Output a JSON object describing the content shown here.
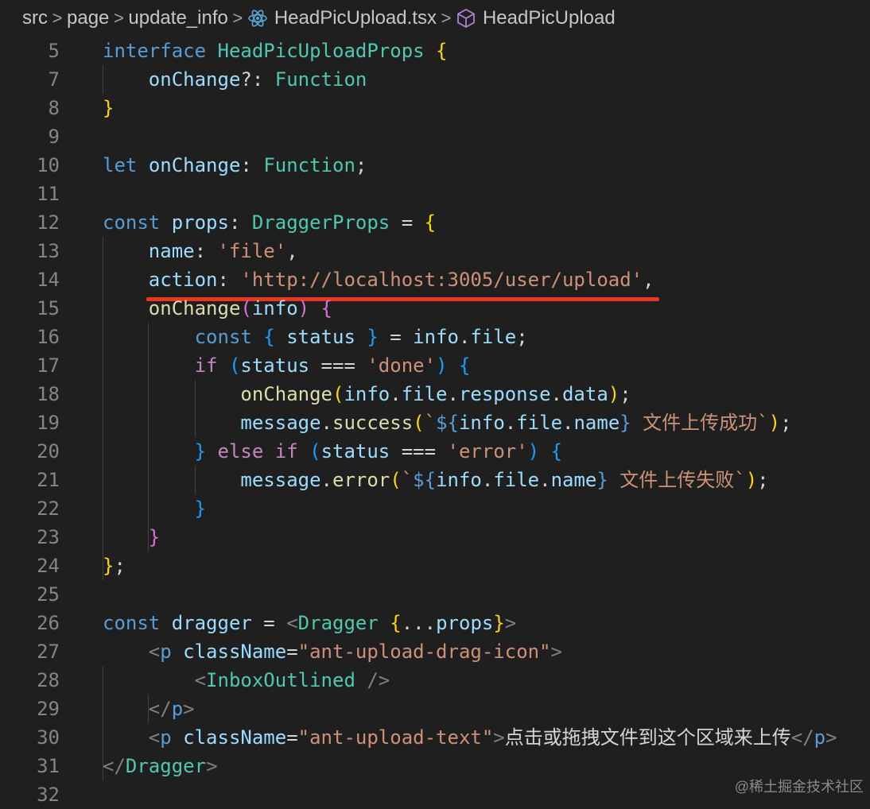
{
  "breadcrumb": {
    "items": [
      "src",
      "page",
      "update_info",
      "HeadPicUpload.tsx",
      "HeadPicUpload"
    ],
    "separator": ">",
    "file_icon": "react-icon",
    "symbol_icon": "cube-icon"
  },
  "colors": {
    "background": "#1f1f1f",
    "keyword": "#569cd6",
    "control": "#c586c0",
    "type": "#4ec9b0",
    "variable": "#9cdcfe",
    "function": "#dcdcaa",
    "string": "#ce9178",
    "bracket_1": "#ffd700",
    "bracket_2": "#da70d6",
    "bracket_3": "#179fff",
    "highlight_underline": "#e8361f"
  },
  "code_lines": [
    {
      "num": "5",
      "tokens": [
        [
          "kw",
          "interface"
        ],
        [
          "pu",
          " "
        ],
        [
          "ty",
          "HeadPicUploadProps"
        ],
        [
          "pu",
          " "
        ],
        [
          "br1",
          "{"
        ]
      ]
    },
    {
      "num": "7",
      "tokens": [
        [
          "pu",
          "    "
        ],
        [
          "id",
          "onChange"
        ],
        [
          "pu",
          "?: "
        ],
        [
          "ty",
          "Function"
        ]
      ]
    },
    {
      "num": "8",
      "tokens": [
        [
          "br1",
          "}"
        ]
      ]
    },
    {
      "num": "9",
      "tokens": []
    },
    {
      "num": "10",
      "tokens": [
        [
          "kw",
          "let"
        ],
        [
          "pu",
          " "
        ],
        [
          "id",
          "onChange"
        ],
        [
          "pu",
          ": "
        ],
        [
          "ty",
          "Function"
        ],
        [
          "pu",
          ";"
        ]
      ]
    },
    {
      "num": "11",
      "tokens": []
    },
    {
      "num": "12",
      "tokens": [
        [
          "kw",
          "const"
        ],
        [
          "pu",
          " "
        ],
        [
          "id",
          "props"
        ],
        [
          "pu",
          ": "
        ],
        [
          "ty",
          "DraggerProps"
        ],
        [
          "pu",
          " = "
        ],
        [
          "br1",
          "{"
        ]
      ]
    },
    {
      "num": "13",
      "tokens": [
        [
          "pu",
          "    "
        ],
        [
          "id",
          "name"
        ],
        [
          "pu",
          ": "
        ],
        [
          "str",
          "'file'"
        ],
        [
          "pu",
          ","
        ]
      ]
    },
    {
      "num": "14",
      "tokens": [
        [
          "pu",
          "    "
        ],
        [
          "id",
          "action"
        ],
        [
          "pu",
          ": "
        ],
        [
          "str",
          "'http://localhost:3005/user/upload'"
        ],
        [
          "pu",
          ","
        ]
      ]
    },
    {
      "num": "15",
      "tokens": [
        [
          "pu",
          "    "
        ],
        [
          "fn",
          "onChange"
        ],
        [
          "br2",
          "("
        ],
        [
          "id",
          "info"
        ],
        [
          "br2",
          ")"
        ],
        [
          "pu",
          " "
        ],
        [
          "br2",
          "{"
        ]
      ]
    },
    {
      "num": "16",
      "tokens": [
        [
          "pu",
          "        "
        ],
        [
          "kw",
          "const"
        ],
        [
          "pu",
          " "
        ],
        [
          "br3",
          "{"
        ],
        [
          "pu",
          " "
        ],
        [
          "id",
          "status"
        ],
        [
          "pu",
          " "
        ],
        [
          "br3",
          "}"
        ],
        [
          "pu",
          " = "
        ],
        [
          "id",
          "info"
        ],
        [
          "pu",
          "."
        ],
        [
          "id",
          "file"
        ],
        [
          "pu",
          ";"
        ]
      ]
    },
    {
      "num": "17",
      "tokens": [
        [
          "pu",
          "        "
        ],
        [
          "ctl",
          "if"
        ],
        [
          "pu",
          " "
        ],
        [
          "br3",
          "("
        ],
        [
          "id",
          "status"
        ],
        [
          "pu",
          " === "
        ],
        [
          "str",
          "'done'"
        ],
        [
          "br3",
          ")"
        ],
        [
          "pu",
          " "
        ],
        [
          "br3",
          "{"
        ]
      ]
    },
    {
      "num": "18",
      "tokens": [
        [
          "pu",
          "            "
        ],
        [
          "fn",
          "onChange"
        ],
        [
          "br1",
          "("
        ],
        [
          "id",
          "info"
        ],
        [
          "pu",
          "."
        ],
        [
          "id",
          "file"
        ],
        [
          "pu",
          "."
        ],
        [
          "id",
          "response"
        ],
        [
          "pu",
          "."
        ],
        [
          "id",
          "data"
        ],
        [
          "br1",
          ")"
        ],
        [
          "pu",
          ";"
        ]
      ]
    },
    {
      "num": "19",
      "tokens": [
        [
          "pu",
          "            "
        ],
        [
          "id",
          "message"
        ],
        [
          "pu",
          "."
        ],
        [
          "fn",
          "success"
        ],
        [
          "br1",
          "("
        ],
        [
          "str",
          "`"
        ],
        [
          "kw",
          "${"
        ],
        [
          "id",
          "info"
        ],
        [
          "pu",
          "."
        ],
        [
          "id",
          "file"
        ],
        [
          "pu",
          "."
        ],
        [
          "id",
          "name"
        ],
        [
          "kw",
          "}"
        ],
        [
          "str",
          " 文件上传成功`"
        ],
        [
          "br1",
          ")"
        ],
        [
          "pu",
          ";"
        ]
      ]
    },
    {
      "num": "20",
      "tokens": [
        [
          "pu",
          "        "
        ],
        [
          "br3",
          "}"
        ],
        [
          "pu",
          " "
        ],
        [
          "ctl",
          "else"
        ],
        [
          "pu",
          " "
        ],
        [
          "ctl",
          "if"
        ],
        [
          "pu",
          " "
        ],
        [
          "br3",
          "("
        ],
        [
          "id",
          "status"
        ],
        [
          "pu",
          " === "
        ],
        [
          "str",
          "'error'"
        ],
        [
          "br3",
          ")"
        ],
        [
          "pu",
          " "
        ],
        [
          "br3",
          "{"
        ]
      ]
    },
    {
      "num": "21",
      "tokens": [
        [
          "pu",
          "            "
        ],
        [
          "id",
          "message"
        ],
        [
          "pu",
          "."
        ],
        [
          "fn",
          "error"
        ],
        [
          "br1",
          "("
        ],
        [
          "str",
          "`"
        ],
        [
          "kw",
          "${"
        ],
        [
          "id",
          "info"
        ],
        [
          "pu",
          "."
        ],
        [
          "id",
          "file"
        ],
        [
          "pu",
          "."
        ],
        [
          "id",
          "name"
        ],
        [
          "kw",
          "}"
        ],
        [
          "str",
          " 文件上传失败`"
        ],
        [
          "br1",
          ")"
        ],
        [
          "pu",
          ";"
        ]
      ]
    },
    {
      "num": "22",
      "tokens": [
        [
          "pu",
          "        "
        ],
        [
          "br3",
          "}"
        ]
      ]
    },
    {
      "num": "23",
      "tokens": [
        [
          "pu",
          "    "
        ],
        [
          "br2",
          "}"
        ]
      ]
    },
    {
      "num": "24",
      "tokens": [
        [
          "br1",
          "}"
        ],
        [
          "pu",
          ";"
        ]
      ]
    },
    {
      "num": "25",
      "tokens": []
    },
    {
      "num": "26",
      "tokens": [
        [
          "kw",
          "const"
        ],
        [
          "pu",
          " "
        ],
        [
          "id",
          "dragger"
        ],
        [
          "pu",
          " = "
        ],
        [
          "tagp",
          "<"
        ],
        [
          "tag",
          "Dragger"
        ],
        [
          "pu",
          " "
        ],
        [
          "br1",
          "{"
        ],
        [
          "pu",
          "..."
        ],
        [
          "id",
          "props"
        ],
        [
          "br1",
          "}"
        ],
        [
          "tagp",
          ">"
        ]
      ]
    },
    {
      "num": "27",
      "tokens": [
        [
          "pu",
          "    "
        ],
        [
          "tagp",
          "<"
        ],
        [
          "kw",
          "p"
        ],
        [
          "pu",
          " "
        ],
        [
          "attr",
          "className"
        ],
        [
          "pu",
          "="
        ],
        [
          "str",
          "\"ant-upload-drag-icon\""
        ],
        [
          "tagp",
          ">"
        ]
      ]
    },
    {
      "num": "28",
      "tokens": [
        [
          "pu",
          "        "
        ],
        [
          "tagp",
          "<"
        ],
        [
          "tag",
          "InboxOutlined"
        ],
        [
          "pu",
          " "
        ],
        [
          "tagp",
          "/>"
        ]
      ]
    },
    {
      "num": "29",
      "tokens": [
        [
          "pu",
          "    "
        ],
        [
          "tagp",
          "</"
        ],
        [
          "kw",
          "p"
        ],
        [
          "tagp",
          ">"
        ]
      ]
    },
    {
      "num": "30",
      "tokens": [
        [
          "pu",
          "    "
        ],
        [
          "tagp",
          "<"
        ],
        [
          "kw",
          "p"
        ],
        [
          "pu",
          " "
        ],
        [
          "attr",
          "className"
        ],
        [
          "pu",
          "="
        ],
        [
          "str",
          "\"ant-upload-text\""
        ],
        [
          "tagp",
          ">"
        ],
        [
          "plain",
          "点击或拖拽文件到这个区域来上传"
        ],
        [
          "tagp",
          "</"
        ],
        [
          "kw",
          "p"
        ],
        [
          "tagp",
          ">"
        ]
      ]
    },
    {
      "num": "31",
      "tokens": [
        [
          "tagp",
          "</"
        ],
        [
          "tag",
          "Dragger"
        ],
        [
          "tagp",
          ">"
        ]
      ]
    },
    {
      "num": "32",
      "tokens": []
    }
  ],
  "watermark": "@稀土掘金技术社区"
}
